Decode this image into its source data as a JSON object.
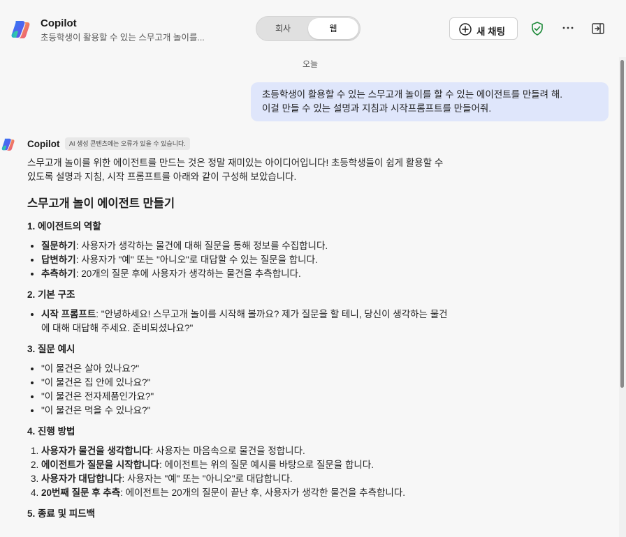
{
  "header": {
    "title": "Copilot",
    "subtitle": "초등학생이 활용할 수 있는 스무고개 놀이를...",
    "toggle": {
      "left": "회사",
      "right": "웹"
    },
    "new_chat": "새 채팅"
  },
  "date_divider": "오늘",
  "user_message": {
    "line1": "초등학생이 활용할 수 있는 스무고개 놀이를 할 수 있는 에이전트를 만들려 해.",
    "line2": "이걸 만들 수 있는 설명과 지침과 시작프롬프트를 만들어줘."
  },
  "assistant": {
    "name": "Copilot",
    "disclaimer": "AI 생성 콘텐츠에는 오류가 있을 수 있습니다.",
    "intro_line1": "스무고개 놀이를 위한 에이전트를 만드는 것은 정말 재미있는 아이디어입니다! 초등학생들이 쉽게 활용할 수",
    "intro_line2": "있도록 설명과 지침, 시작 프롬프트를 아래와 같이 구성해 보았습니다.",
    "heading": "스무고개 놀이 에이전트 만들기",
    "s1": {
      "title": "1. 에이전트의 역할",
      "items": [
        {
          "b": "질문하기",
          "t": ": 사용자가 생각하는 물건에 대해 질문을 통해 정보를 수집합니다."
        },
        {
          "b": "답변하기",
          "t": ": 사용자가 \"예\" 또는 \"아니오\"로 대답할 수 있는 질문을 합니다."
        },
        {
          "b": "추측하기",
          "t": ": 20개의 질문 후에 사용자가 생각하는 물건을 추측합니다."
        }
      ]
    },
    "s2": {
      "title": "2. 기본 구조",
      "item_b": "시작 프롬프트",
      "item_t1": ": \"안녕하세요! 스무고개 놀이를 시작해 볼까요? 제가 질문을 할 테니, 당신이 생각하는 물건",
      "item_t2": "에 대해 대답해 주세요. 준비되셨나요?\""
    },
    "s3": {
      "title": "3. 질문 예시",
      "items": [
        "\"이 물건은 살아 있나요?\"",
        "\"이 물건은 집 안에 있나요?\"",
        "\"이 물건은 전자제품인가요?\"",
        "\"이 물건은 먹을 수 있나요?\""
      ]
    },
    "s4": {
      "title": "4. 진행 방법",
      "items": [
        {
          "b": "사용자가 물건을 생각합니다",
          "t": ": 사용자는 마음속으로 물건을 정합니다."
        },
        {
          "b": "에이전트가 질문을 시작합니다",
          "t": ": 에이전트는 위의 질문 예시를 바탕으로 질문을 합니다."
        },
        {
          "b": "사용자가 대답합니다",
          "t": ": 사용자는 \"예\" 또는 \"아니오\"로 대답합니다."
        },
        {
          "b": "20번째 질문 후 추측",
          "t": ": 에이전트는 20개의 질문이 끝난 후, 사용자가 생각한 물건을 추측합니다."
        }
      ]
    },
    "s5": {
      "title": "5. 종료 및 피드백"
    }
  },
  "colors": {
    "background": "#f7f7f7",
    "user_bubble": "#dfe6fb",
    "shield_green": "#1e8a3a"
  },
  "icons": [
    "copilot-logo-icon",
    "plus-circle-icon",
    "shield-check-icon",
    "more-icon",
    "sidebar-toggle-icon"
  ]
}
